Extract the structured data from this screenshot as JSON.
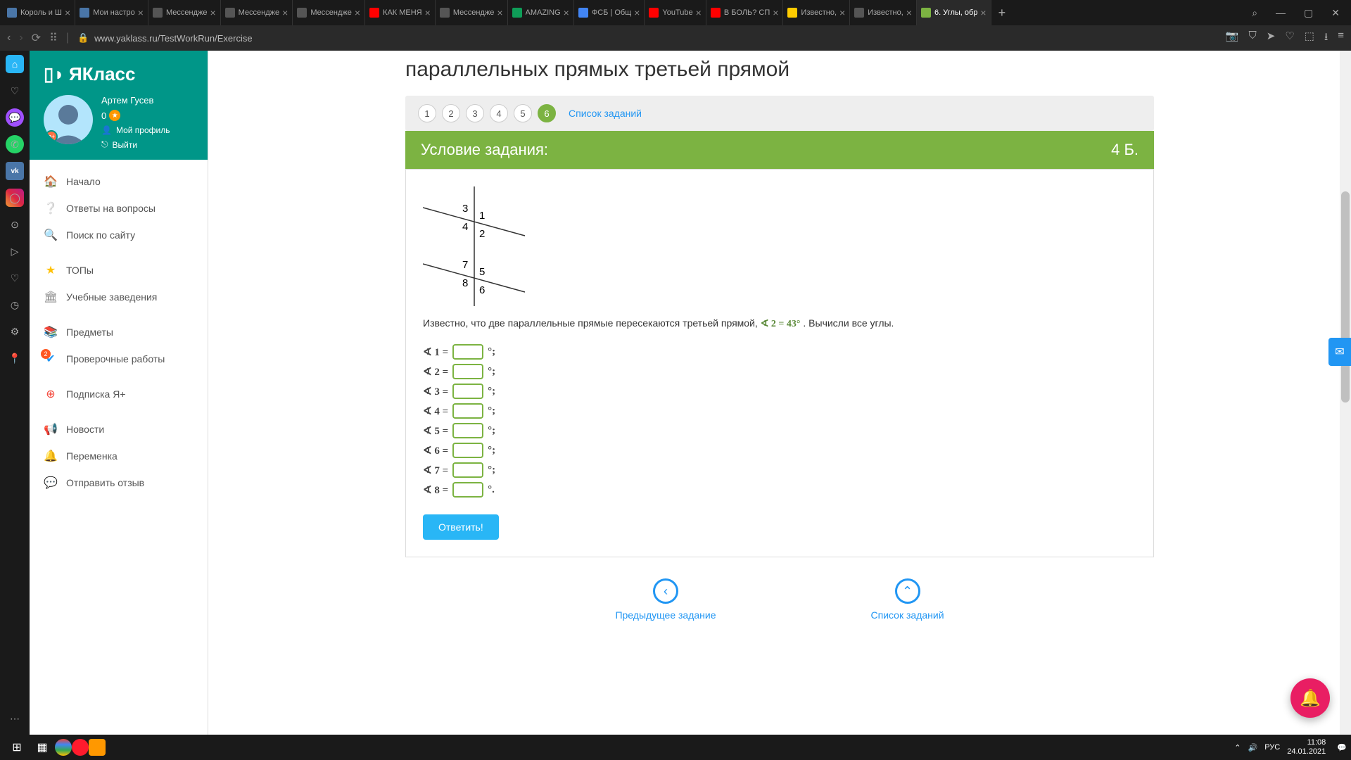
{
  "tabs": [
    {
      "icon": "vk",
      "label": "Король и Ш"
    },
    {
      "icon": "vk",
      "label": "Мои настро"
    },
    {
      "icon": "",
      "label": "Мессендже"
    },
    {
      "icon": "",
      "label": "Мессендже"
    },
    {
      "icon": "",
      "label": "Мессендже"
    },
    {
      "icon": "yt",
      "label": "КАК МЕНЯ"
    },
    {
      "icon": "",
      "label": "Мессендже"
    },
    {
      "icon": "gsheet",
      "label": "AMAZING"
    },
    {
      "icon": "gdoc",
      "label": "ФСБ | Общ"
    },
    {
      "icon": "yt",
      "label": "YouTube"
    },
    {
      "icon": "yt",
      "label": "В БОЛЬ? СП"
    },
    {
      "icon": "ya",
      "label": "Известно,"
    },
    {
      "icon": "",
      "label": "Известно,"
    },
    {
      "icon": "yak",
      "label": "6. Углы, обр",
      "active": true
    }
  ],
  "url": "www.yaklass.ru/TestWorkRun/Exercise",
  "brand": "ЯКласс",
  "user": {
    "name": "Артем Гусев",
    "points": "0",
    "profile": "Мой профиль",
    "logout": "Выйти"
  },
  "nav": {
    "home": "Начало",
    "faq": "Ответы на вопросы",
    "search": "Поиск по сайту",
    "top": "ТОПы",
    "schools": "Учебные заведения",
    "subjects": "Предметы",
    "tests": "Проверочные работы",
    "sub": "Подписка Я+",
    "news": "Новости",
    "break": "Переменка",
    "feedback": "Отправить отзыв"
  },
  "page": {
    "title": "параллельных прямых третьей прямой",
    "steps": [
      "1",
      "2",
      "3",
      "4",
      "5",
      "6"
    ],
    "active_step": 6,
    "list_link": "Список заданий",
    "cond_title": "Условие задания:",
    "points": "4 Б.",
    "diagram_labels": {
      "a1": "1",
      "a2": "2",
      "a3": "3",
      "a4": "4",
      "a5": "5",
      "a6": "6",
      "a7": "7",
      "a8": "8"
    },
    "text_before": "Известно, что две параллельные прямые пересекаются третьей прямой, ",
    "given": "∢ 2 = 43°",
    "text_after": ". Вычисли все углы.",
    "angles": [
      {
        "n": "1",
        "tail": "°;"
      },
      {
        "n": "2",
        "tail": "°;"
      },
      {
        "n": "3",
        "tail": "°;"
      },
      {
        "n": "4",
        "tail": "°;"
      },
      {
        "n": "5",
        "tail": "°;"
      },
      {
        "n": "6",
        "tail": "°;"
      },
      {
        "n": "7",
        "tail": "°;"
      },
      {
        "n": "8",
        "tail": "°."
      }
    ],
    "answer_btn": "Ответить!",
    "prev": "Предыдущее задание",
    "tasks": "Список заданий"
  },
  "system": {
    "lang": "РУС",
    "time": "11:08",
    "date": "24.01.2021"
  }
}
